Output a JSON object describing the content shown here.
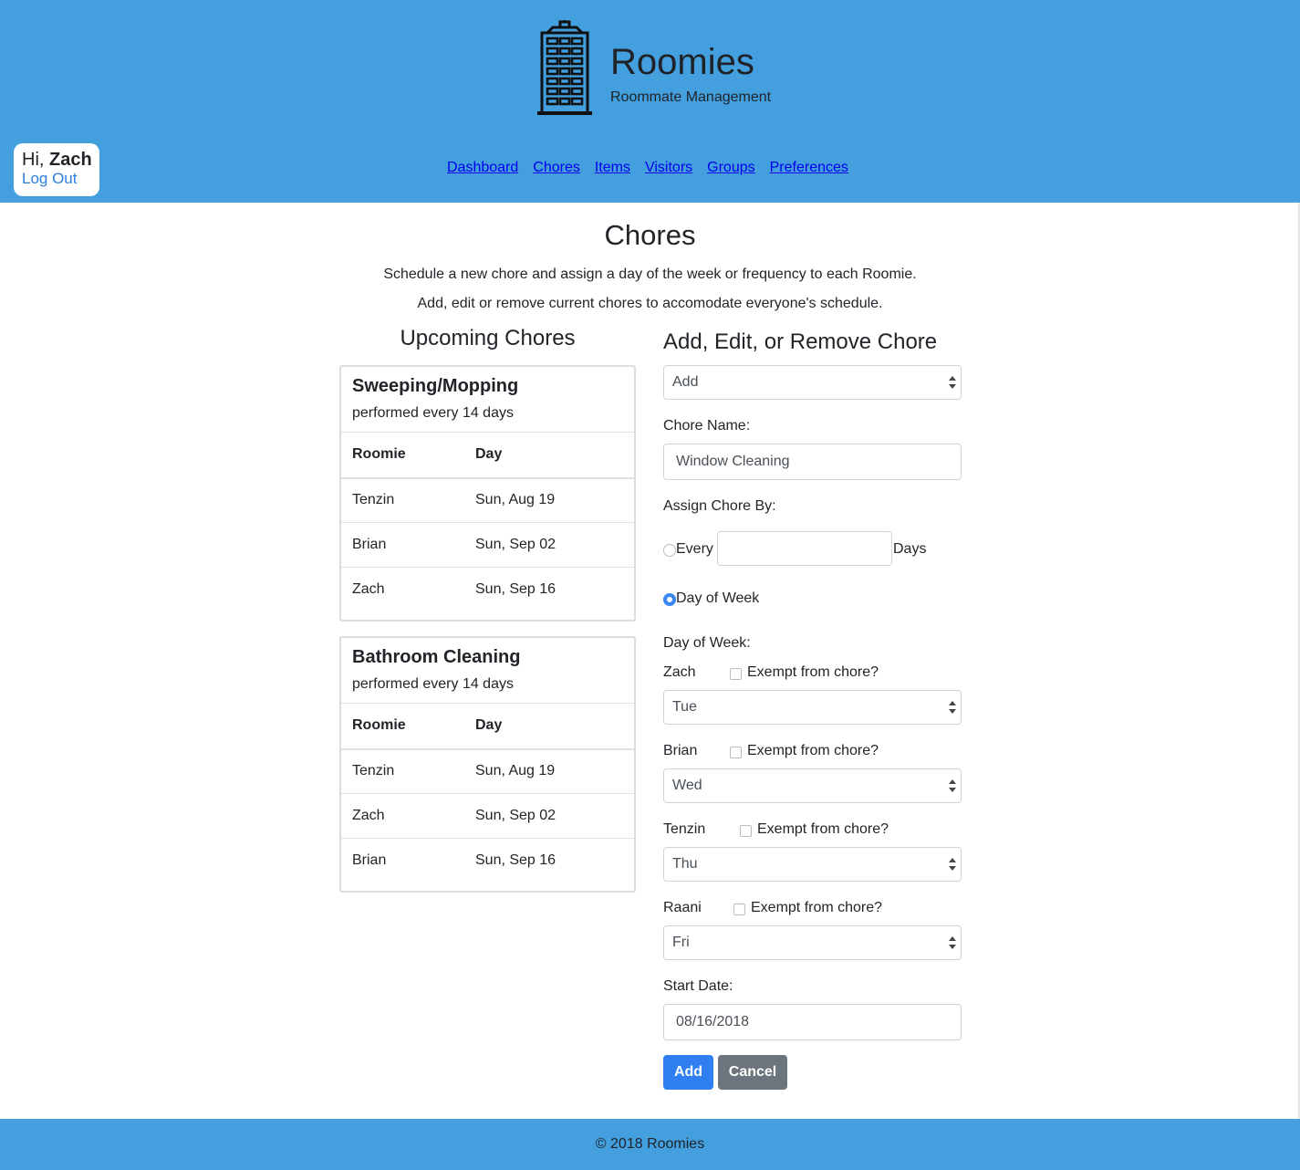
{
  "app": {
    "name": "Roomies",
    "tagline": "Roommate Management",
    "accent_color": "#439fde"
  },
  "user": {
    "greeting_prefix": "Hi,",
    "name": "Zach",
    "logout_label": "Log Out"
  },
  "nav": {
    "items": [
      "Dashboard",
      "Chores",
      "Items",
      "Visitors",
      "Groups",
      "Preferences"
    ]
  },
  "page": {
    "title": "Chores",
    "intro_line1": "Schedule a new chore and assign a day of the week or frequency to each Roomie.",
    "intro_line2": "Add, edit or remove current chores to accomodate everyone's schedule."
  },
  "upcoming": {
    "heading": "Upcoming Chores",
    "column_headers": [
      "Roomie",
      "Day"
    ],
    "chores": [
      {
        "name": "Sweeping/Mopping",
        "frequency": "performed every 14 days",
        "rows": [
          {
            "roomie": "Tenzin",
            "day": "Sun, Aug 19"
          },
          {
            "roomie": "Brian",
            "day": "Sun, Sep 02"
          },
          {
            "roomie": "Zach",
            "day": "Sun, Sep 16"
          }
        ]
      },
      {
        "name": "Bathroom Cleaning",
        "frequency": "performed every 14 days",
        "rows": [
          {
            "roomie": "Tenzin",
            "day": "Sun, Aug 19"
          },
          {
            "roomie": "Zach",
            "day": "Sun, Sep 02"
          },
          {
            "roomie": "Brian",
            "day": "Sun, Sep 16"
          }
        ]
      }
    ]
  },
  "form": {
    "heading": "Add, Edit, or Remove Chore",
    "mode_value": "Add",
    "chore_name_label": "Chore Name:",
    "chore_name_value": "Window Cleaning",
    "assign_by_label": "Assign Chore By:",
    "every_label": "Every",
    "every_value": "",
    "days_label": "Days",
    "day_of_week_option": "Day of Week",
    "assign_by_selected": "Day of Week",
    "day_of_week_label": "Day of Week:",
    "exempt_label": "Exempt from chore?",
    "roomies": [
      {
        "name": "Zach",
        "day": "Tue",
        "exempt": false
      },
      {
        "name": "Brian",
        "day": "Wed",
        "exempt": false
      },
      {
        "name": "Tenzin",
        "day": "Thu",
        "exempt": false
      },
      {
        "name": "Raani",
        "day": "Fri",
        "exempt": false
      }
    ],
    "start_date_label": "Start Date:",
    "start_date_value": "08/16/2018",
    "add_button": "Add",
    "cancel_button": "Cancel"
  },
  "footer": {
    "copyright": "© 2018 Roomies"
  }
}
